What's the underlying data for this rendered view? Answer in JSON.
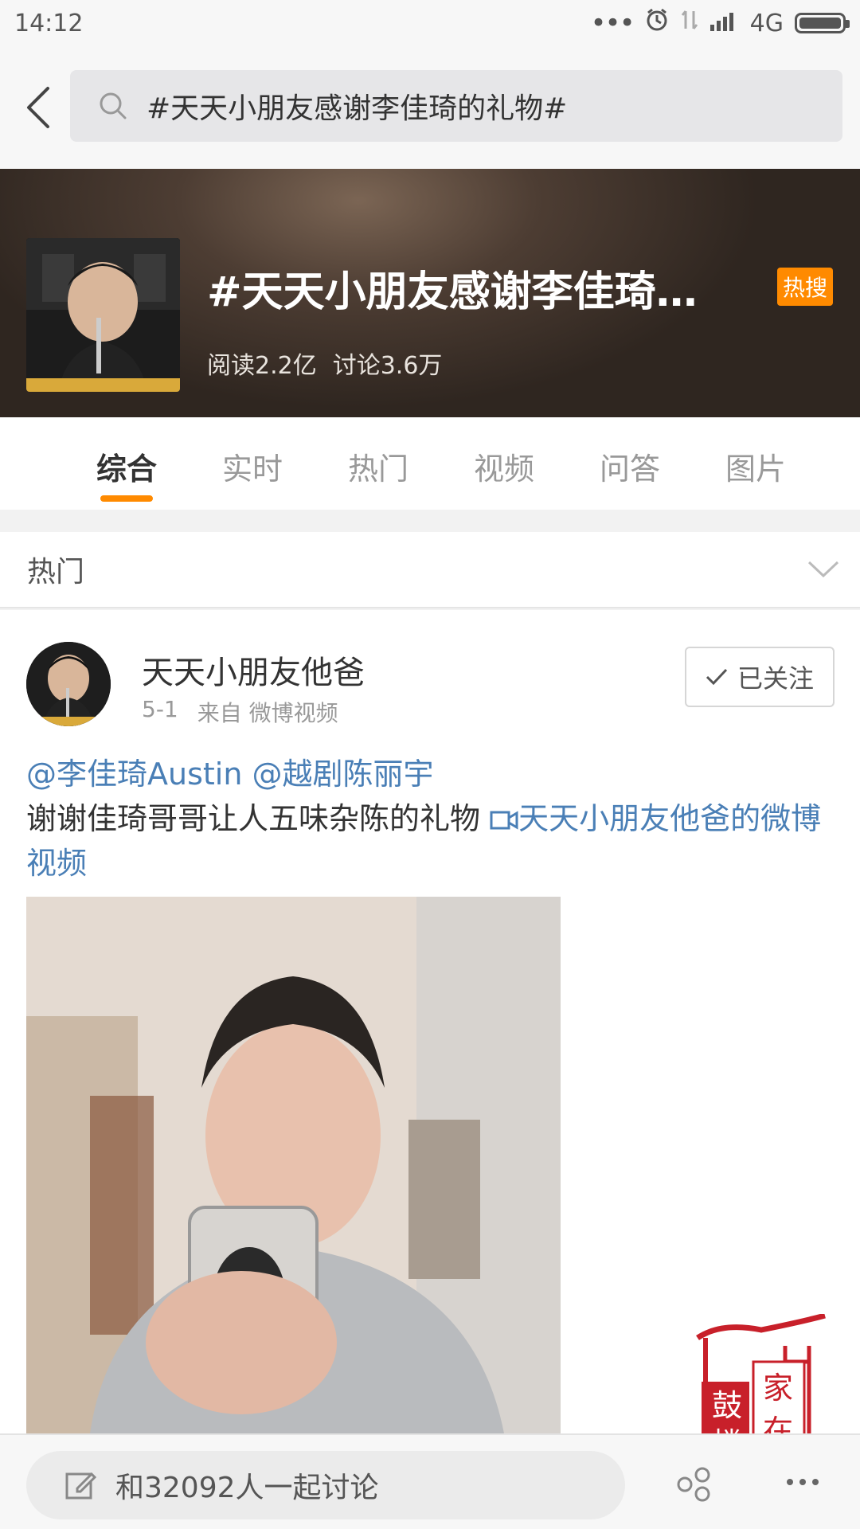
{
  "status_bar": {
    "time": "14:12",
    "network": "4G"
  },
  "search": {
    "query": "#天天小朋友感谢李佳琦的礼物#"
  },
  "topic": {
    "title": "#天天小朋友感谢李佳琦…",
    "badge": "热搜",
    "reads": "阅读2.2亿",
    "discussions": "讨论3.6万"
  },
  "tabs": [
    {
      "label": "综合"
    },
    {
      "label": "实时"
    },
    {
      "label": "热门"
    },
    {
      "label": "视频"
    },
    {
      "label": "问答"
    },
    {
      "label": "图片"
    }
  ],
  "section": {
    "title": "热门"
  },
  "post": {
    "author": "天天小朋友他爸",
    "date": "5-1",
    "source": "来自 微博视频",
    "follow_label": "已关注",
    "mention1": "@李佳琦Austin",
    "mention2": "@越剧陈丽宇",
    "text": "谢谢佳琦哥哥让人五味杂陈的礼物",
    "video_link": "天天小朋友他爸的微博视频"
  },
  "stamp": {
    "chars": [
      "家",
      "鼓",
      "在",
      "楼"
    ]
  },
  "bottom_bar": {
    "discuss_placeholder": "和32092人一起讨论"
  },
  "colors": {
    "accent": "#ff8a00",
    "link": "#4a7fb6"
  }
}
